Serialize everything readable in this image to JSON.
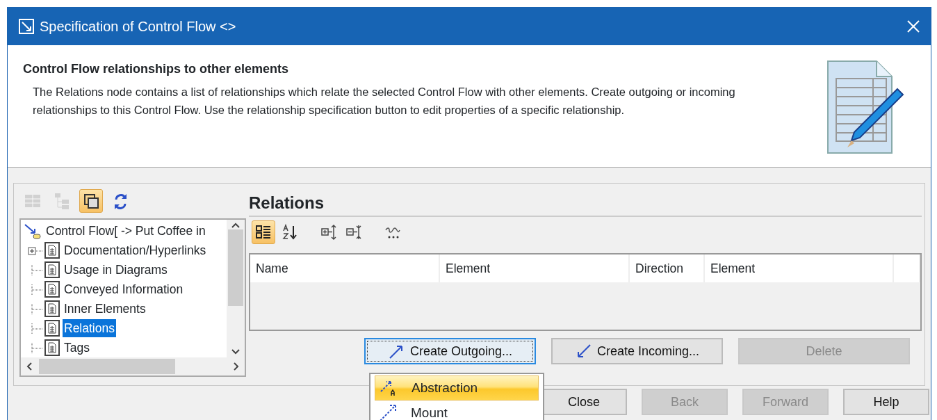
{
  "window": {
    "title": "Specification of Control Flow <>"
  },
  "header": {
    "heading": "Control Flow relationships to other elements",
    "description": "The Relations node contains a list of relationships which relate the selected Control Flow with other elements. Create outgoing or incoming relationships to this Control Flow. Use the relationship specification button to edit properties of a specific relationship."
  },
  "tree_toolbar": [
    {
      "kind": "table",
      "selected": false,
      "disabled": true
    },
    {
      "kind": "tree",
      "selected": false,
      "disabled": true
    },
    {
      "kind": "copy",
      "selected": true,
      "disabled": false
    },
    {
      "kind": "refresh",
      "selected": false,
      "disabled": false
    }
  ],
  "tree": {
    "label": "Control Flow[ -> Put Coffee in",
    "selected": false,
    "children": [
      {
        "label": "Documentation/Hyperlinks",
        "expandable": true,
        "selected": false
      },
      {
        "label": "Usage in Diagrams",
        "expandable": false,
        "selected": false
      },
      {
        "label": "Conveyed Information",
        "expandable": false,
        "selected": false
      },
      {
        "label": "Inner Elements",
        "expandable": false,
        "selected": false
      },
      {
        "label": "Relations",
        "expandable": false,
        "selected": true
      },
      {
        "label": "Tags",
        "expandable": false,
        "selected": false
      }
    ]
  },
  "panel": {
    "title": "Relations"
  },
  "panel_toolbar": [
    {
      "kind": "grid",
      "selected": true
    },
    {
      "kind": "sort",
      "selected": false
    },
    {
      "kind": "expand",
      "selected": false
    },
    {
      "kind": "collapse",
      "selected": false
    },
    {
      "kind": "abc",
      "selected": false
    }
  ],
  "table": {
    "columns": [
      "Name",
      "Element",
      "Direction",
      "Element"
    ]
  },
  "actions": [
    {
      "label": "Create Outgoing...",
      "kind": "outgoing",
      "focused": true,
      "disabled": false
    },
    {
      "label": "Create Incoming...",
      "kind": "incoming",
      "focused": false,
      "disabled": false
    },
    {
      "label": "Delete",
      "kind": "plain",
      "focused": false,
      "disabled": true
    }
  ],
  "menu": [
    {
      "label": "Abstraction",
      "kind": "abstraction",
      "selected": true
    },
    {
      "label": "Mount",
      "kind": "mount",
      "selected": false
    }
  ],
  "buttons": [
    {
      "label": "Close",
      "disabled": false
    },
    {
      "label": "Back",
      "disabled": true
    },
    {
      "label": "Forward",
      "disabled": true
    },
    {
      "label": "Help",
      "disabled": false
    }
  ]
}
